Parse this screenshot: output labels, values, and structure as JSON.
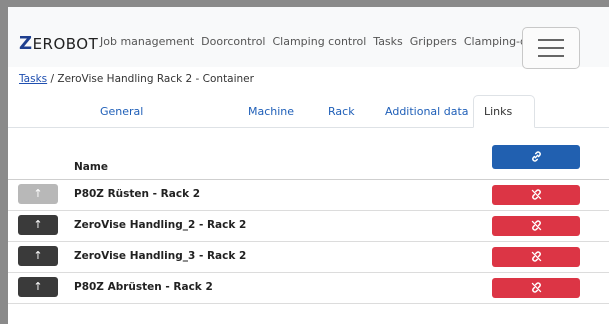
{
  "navbar": {
    "brand_initial": "Z",
    "brand_rest": "EROBOT",
    "links": [
      "Job management",
      "Doorcontrol",
      "Clamping control",
      "Tasks",
      "Grippers",
      "Clamping-devices"
    ],
    "menu_icon": "hamburger-icon"
  },
  "breadcrumb": {
    "root": "Tasks",
    "separator": "/",
    "current": "ZeroVise Handling Rack 2 - Container"
  },
  "tabs": [
    "General",
    "Machine",
    "Rack",
    "Additional data",
    "Links"
  ],
  "active_tab": "Links",
  "table": {
    "header_name": "Name",
    "link_button_icon": "link-icon",
    "unlink_button_icon": "unlink-icon",
    "move_up_icon": "arrow-up-icon",
    "rows": [
      {
        "name": "P80Z Rüsten - Rack 2",
        "up_disabled": true
      },
      {
        "name": "ZeroVise Handling_2 - Rack 2",
        "up_disabled": false
      },
      {
        "name": "ZeroVise Handling_3 - Rack 2",
        "up_disabled": false
      },
      {
        "name": "P80Z Abrüsten - Rack 2",
        "up_disabled": false
      }
    ]
  },
  "colors": {
    "brand": "#1f3f8f",
    "link": "#1f5fb8",
    "primary_button": "#2160b0",
    "danger_button": "#dc3545",
    "dark_button": "#3a3a3a",
    "disabled_button": "#b8b8b8"
  }
}
